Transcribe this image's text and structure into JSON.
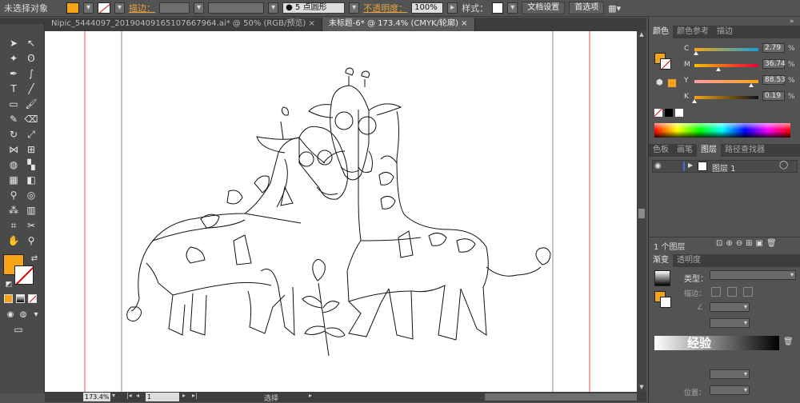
{
  "control_bar": {
    "selection": "未选择对象",
    "stroke_label": "描边：",
    "brush_value": "5 点圆形",
    "opacity_label": "不透明度：",
    "opacity_value": "100%",
    "style_label": "样式：",
    "doc_setup": "文档设置",
    "prefs": "首选项",
    "fill_color": "#f5a419",
    "accent": "#e8a33d"
  },
  "tabs": [
    {
      "label": "Nipic_5444097_20190409165107667964.ai* @ 50% (RGB/预览)",
      "close": "×"
    },
    {
      "label": "未标题-6* @ 173.4% (CMYK/轮廓)",
      "close": "×"
    }
  ],
  "status": {
    "zoom": "173.4%",
    "page": "1",
    "tool": "选择"
  },
  "color_panel": {
    "tabs": [
      "颜色",
      "颜色参考",
      "描边"
    ],
    "channels": [
      {
        "label": "C",
        "value": "2.79",
        "unit": "%",
        "level": 0.03,
        "grad": "linear-gradient(90deg,#f5a419,#19a0d6)"
      },
      {
        "label": "M",
        "value": "36.74",
        "unit": "%",
        "level": 0.37,
        "grad": "linear-gradient(90deg,#f5c000,#e8003a)"
      },
      {
        "label": "Y",
        "value": "88.53",
        "unit": "%",
        "level": 0.89,
        "grad": "linear-gradient(90deg,#ff9ea0,#f9a31a)"
      },
      {
        "label": "K",
        "value": "0.19",
        "unit": "%",
        "level": 0.0,
        "grad": "linear-gradient(90deg,#f5a419,#111)"
      }
    ]
  },
  "layers_panel": {
    "tabs": [
      "色板",
      "画笔",
      "图层",
      "路径查找器"
    ],
    "layer_name": "图层 1",
    "footer": "1 个图层"
  },
  "gradient_panel": {
    "tabs": [
      "渐变",
      "透明度"
    ],
    "type_label": "类型：",
    "stroke_label": "描边：",
    "position_label": "位置："
  },
  "watermark": "经验"
}
